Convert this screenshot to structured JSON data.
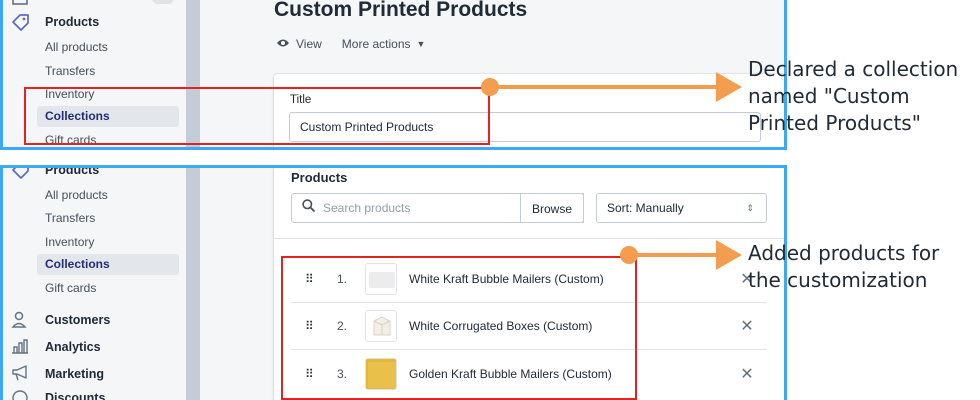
{
  "top_panel": {
    "sidebar": {
      "products_label": "Products",
      "sub_items": [
        "All products",
        "Transfers",
        "Inventory",
        "Collections",
        "Gift cards"
      ],
      "active": "Collections"
    },
    "page_title": "Custom Printed Products",
    "view_label": "View",
    "more_actions_label": "More actions",
    "title_field": {
      "label": "Title",
      "value": "Custom Printed Products"
    }
  },
  "bottom_panel": {
    "sidebar": {
      "products_label": "Products",
      "sub_items": [
        "All products",
        "Transfers",
        "Inventory",
        "Collections",
        "Gift cards"
      ],
      "active": "Collections",
      "main_items": [
        "Customers",
        "Analytics",
        "Marketing",
        "Discounts"
      ]
    },
    "products_card": {
      "heading": "Products",
      "search_placeholder": "Search products",
      "browse_label": "Browse",
      "sort_label": "Sort: Manually",
      "rows": [
        {
          "num": "1.",
          "name": "White Kraft Bubble Mailers (Custom)",
          "thumb_color": "#f1f1f1"
        },
        {
          "num": "2.",
          "name": "White Corrugated Boxes (Custom)",
          "thumb_color": "#f6f4ef"
        },
        {
          "num": "3.",
          "name": "Golden Kraft Bubble Mailers (Custom)",
          "thumb_color": "#e4b634"
        }
      ]
    }
  },
  "annotations": {
    "first": "Declared a collection named \"Custom Printed Products\"",
    "second": "Added products for the customization"
  },
  "colors": {
    "panel_border": "#3da9f5",
    "highlight": "#e32222",
    "callout": "#f49d4f",
    "active_nav": "#202e78"
  }
}
